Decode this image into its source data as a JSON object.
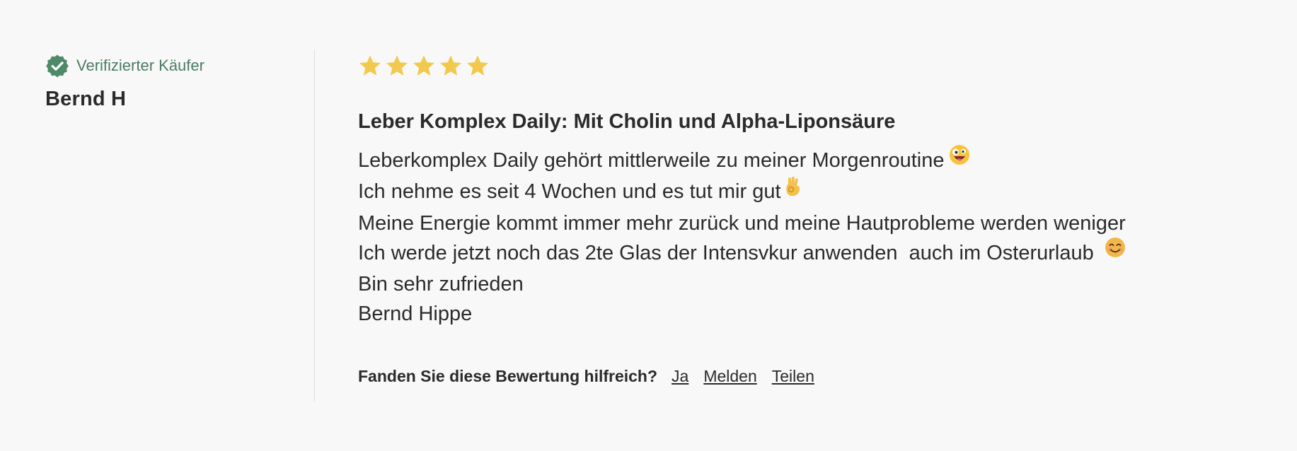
{
  "author": {
    "verified_label": "Verifizierter Käufer",
    "name": "Bernd H",
    "verified_icon": "verified-check-badge-icon"
  },
  "rating": {
    "value": 5,
    "max": 5,
    "star_color": "#f2c94c",
    "star_icon": "star-icon"
  },
  "review": {
    "title": "Leber Komplex Daily: Mit Cholin und Alpha-Liponsäure",
    "lines": [
      "Leberkomplex Daily gehört mittlerweile zu meiner Morgenroutine",
      "Ich nehme es seit 4 Wochen und es tut mir gut",
      "Meine Energie kommt immer mehr zurück und meine Hautprobleme werden weniger",
      "Ich werde jetzt noch das 2te Glas der Intensvkur anwenden  auch im Osterurlaub",
      "Bin sehr zufrieden",
      "Bernd Hippe"
    ],
    "line_emojis": [
      "zany-face-emoji",
      "ok-hand-emoji",
      "",
      "smiling-face-emoji",
      "",
      ""
    ]
  },
  "helpful": {
    "question": "Fanden Sie diese Bewertung hilfreich?",
    "yes_label": "Ja",
    "report_label": "Melden",
    "share_label": "Teilen"
  },
  "colors": {
    "background": "#f8f8f8",
    "verified_green": "#4c7d62",
    "text": "#2b2b2b",
    "divider": "#dcdcdc"
  }
}
